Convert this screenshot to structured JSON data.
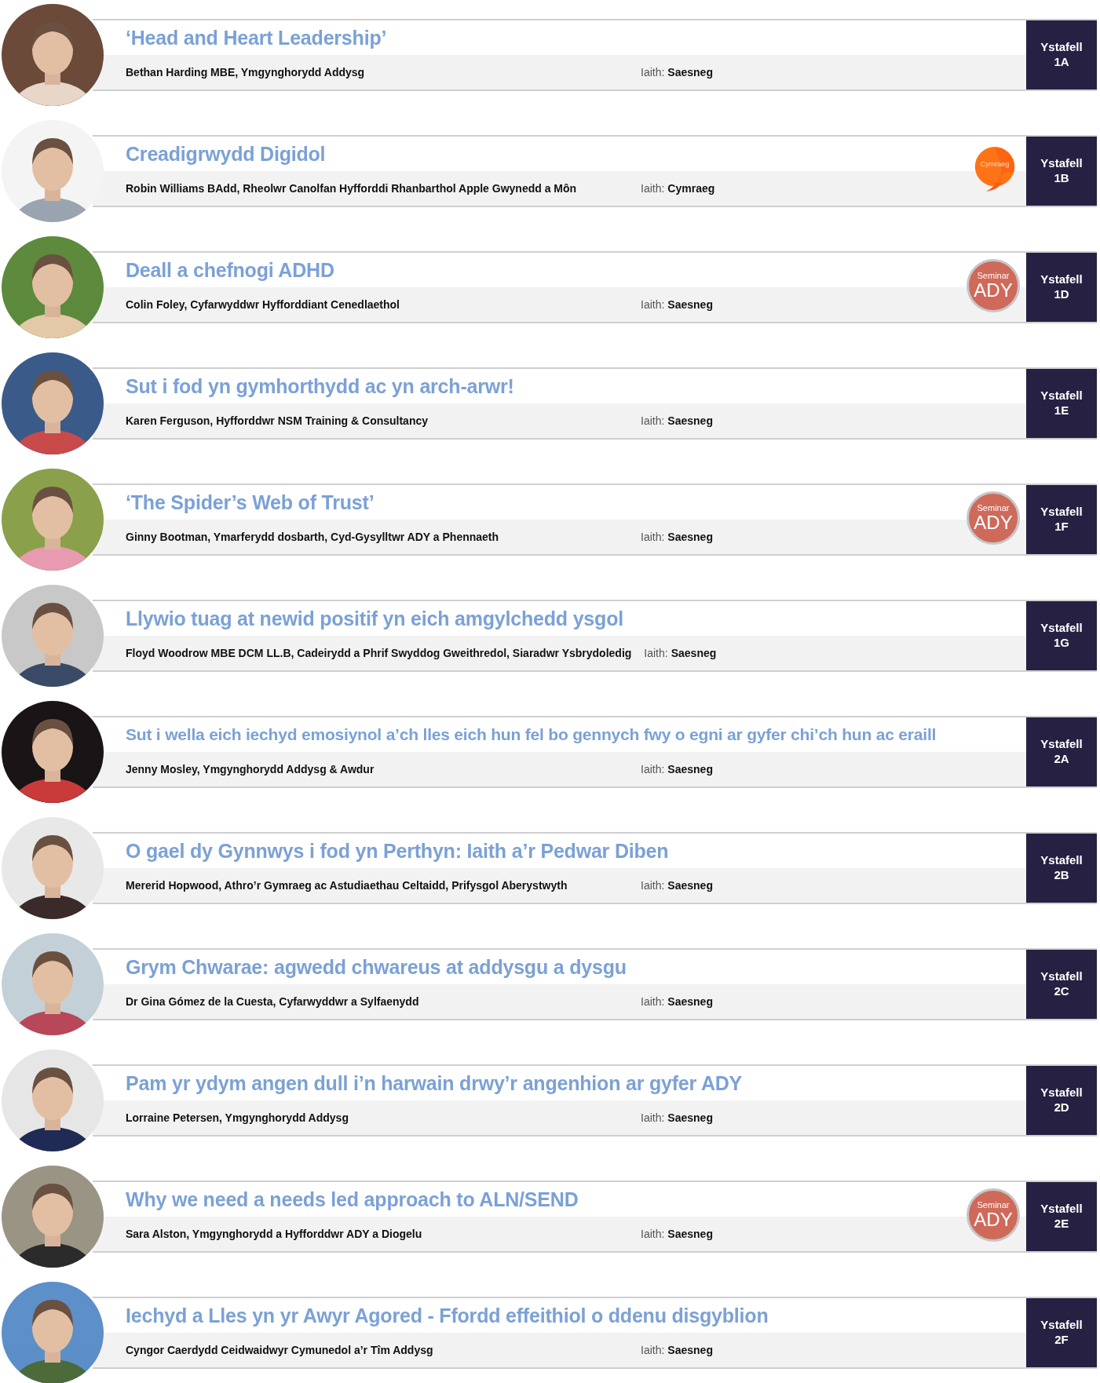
{
  "sessions": [
    {
      "title": "‘Head and Heart Leadership’",
      "speaker": "Bethan Harding MBE, Ymgynghorydd Addysg",
      "language_label": "Iaith:",
      "language": "Saesneg",
      "room_label": "Ystafell",
      "room": "1A"
    },
    {
      "title": "Creadigrwydd Digidol",
      "speaker": "Robin Williams BAdd, Rheolwr Canolfan Hyfforddi Rhanbarthol Apple Gwynedd a Môn",
      "language_label": "Iaith:",
      "language": "Cymraeg",
      "room_label": "Ystafell",
      "room": "1B",
      "badge": {
        "kind": "cymraeg",
        "text": "Cymraeg"
      }
    },
    {
      "title": "Deall a chefnogi ADHD",
      "speaker": "Colin Foley, Cyfarwyddwr Hyfforddiant Cenedlaethol",
      "language_label": "Iaith:",
      "language": "Saesneg",
      "room_label": "Ystafell",
      "room": "1D",
      "badge": {
        "kind": "seminar",
        "top": "Seminar",
        "text": "ADY"
      }
    },
    {
      "title": "Sut i fod yn gymhorthydd ac yn arch-arwr!",
      "speaker": "Karen Ferguson, Hyfforddwr NSM Training & Consultancy",
      "language_label": "Iaith:",
      "language": "Saesneg",
      "room_label": "Ystafell",
      "room": "1E"
    },
    {
      "title": "‘The Spider’s Web of Trust’",
      "speaker": "Ginny Bootman, Ymarferydd dosbarth, Cyd-Gysylltwr ADY a Phennaeth",
      "language_label": "Iaith:",
      "language": "Saesneg",
      "room_label": "Ystafell",
      "room": "1F",
      "badge": {
        "kind": "seminar",
        "top": "Seminar",
        "text": "ADY"
      }
    },
    {
      "title": "Llywio tuag at newid positif yn eich amgylchedd ysgol",
      "speaker": "Floyd Woodrow MBE DCM LL.B, Cadeirydd a Phrif Swyddog Gweithredol, Siaradwr Ysbrydoledig",
      "language_label": "Iaith:",
      "language": "Saesneg",
      "room_label": "Ystafell",
      "room": "1G"
    },
    {
      "title": "Sut i wella eich iechyd emosiynol a’ch lles eich hun fel bo gennych fwy o egni ar gyfer chi’ch hun ac eraill",
      "speaker": "Jenny Mosley, Ymgynghorydd Addysg & Awdur",
      "language_label": "Iaith:",
      "language": "Saesneg",
      "room_label": "Ystafell",
      "room": "2A"
    },
    {
      "title": "O gael dy Gynnwys i fod yn Perthyn: Iaith a’r Pedwar Diben",
      "speaker": "Mererid Hopwood, Athro’r Gymraeg ac Astudiaethau Celtaidd, Prifysgol Aberystwyth",
      "language_label": "Iaith:",
      "language": "Saesneg",
      "room_label": "Ystafell",
      "room": "2B"
    },
    {
      "title": "Grym Chwarae: agwedd chwareus at addysgu a dysgu",
      "speaker": "Dr Gina Gómez de la Cuesta, Cyfarwyddwr a Sylfaenydd",
      "language_label": "Iaith:",
      "language": "Saesneg",
      "room_label": "Ystafell",
      "room": "2C"
    },
    {
      "title": "Pam yr ydym angen dull i’n harwain drwy’r angenhion ar gyfer ADY",
      "speaker": "Lorraine Petersen, Ymgynghorydd Addysg",
      "language_label": "Iaith:",
      "language": "Saesneg",
      "room_label": "Ystafell",
      "room": "2D"
    },
    {
      "title": "Why we need a needs led approach to ALN/SEND",
      "speaker": "Sara Alston, Ymgynghorydd a Hyfforddwr ADY a Diogelu",
      "language_label": "Iaith:",
      "language": "Saesneg",
      "room_label": "Ystafell",
      "room": "2E",
      "badge": {
        "kind": "seminar",
        "top": "Seminar",
        "text": "ADY"
      }
    },
    {
      "title": "Iechyd a Lles yn yr Awyr Agored - Ffordd effeithiol o ddenu disgyblion",
      "speaker": "Cyngor Caerdydd Ceidwaidwyr Cymunedol a’r Tîm Addysg",
      "language_label": "Iaith:",
      "language": "Saesneg",
      "room_label": "Ystafell",
      "room": "2F"
    }
  ]
}
